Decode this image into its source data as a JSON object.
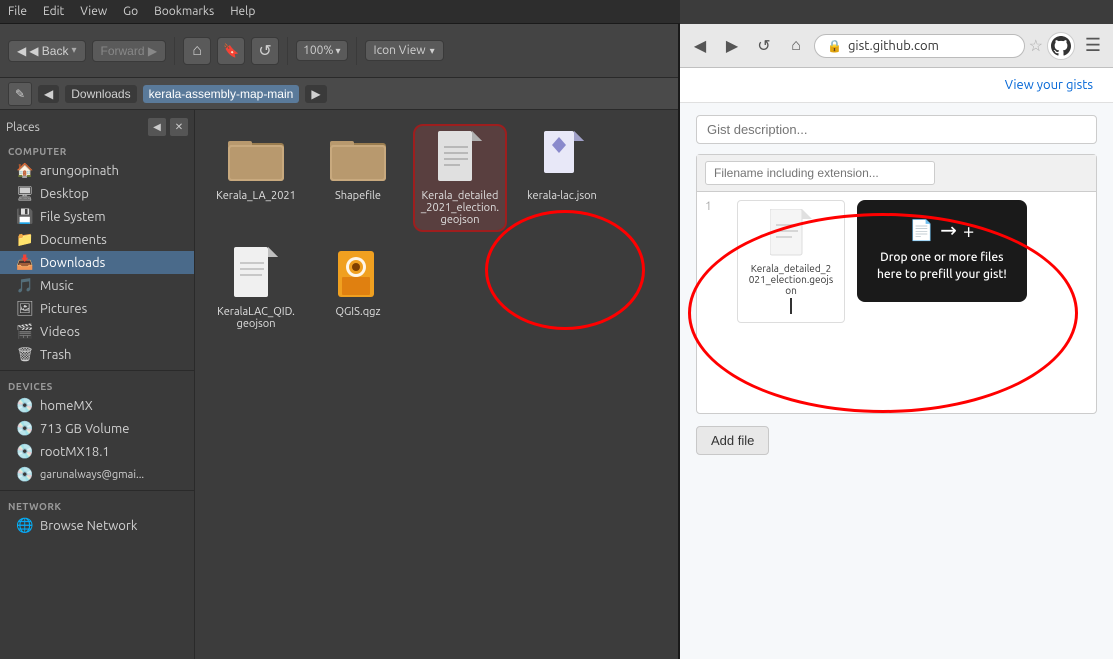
{
  "menubar": {
    "items": [
      "File",
      "Edit",
      "View",
      "Go",
      "Bookmarks",
      "Help"
    ]
  },
  "toolbar": {
    "back_label": "◀ Back",
    "back_dropdown": "▾",
    "forward_label": "Forward ▶",
    "home_symbol": "⌂",
    "bookmark_symbol": "🔖",
    "reload_symbol": "↺",
    "percent_label": "100%",
    "percent_dropdown": "▾",
    "view_label": "Icon View",
    "view_dropdown": "▾"
  },
  "breadcrumb": {
    "edit_symbol": "✎",
    "back_arrow": "◀",
    "path_parts": [
      "Downloads",
      "kerala-assembly-map-main"
    ],
    "forward_arrow": "▶"
  },
  "sidebar": {
    "header_label": "Places",
    "collapse_label": "◀",
    "close_label": "✕",
    "section_computer": "Computer",
    "items_computer": [
      {
        "label": "arungopinath",
        "icon": "🏠"
      },
      {
        "label": "Desktop",
        "icon": "🖥"
      },
      {
        "label": "File System",
        "icon": "💾"
      },
      {
        "label": "Documents",
        "icon": "📁"
      },
      {
        "label": "Downloads",
        "icon": "📥"
      },
      {
        "label": "Music",
        "icon": "🎵"
      },
      {
        "label": "Pictures",
        "icon": "🖼"
      },
      {
        "label": "Videos",
        "icon": "🎬"
      },
      {
        "label": "Trash",
        "icon": "🗑"
      }
    ],
    "section_devices": "Devices",
    "items_devices": [
      {
        "label": "homeMX",
        "icon": "💿"
      },
      {
        "label": "713 GB Volume",
        "icon": "💿"
      },
      {
        "label": "rootMX18.1",
        "icon": "💿"
      },
      {
        "label": "garunalways@gmai...",
        "icon": "💿"
      }
    ],
    "section_network": "Network",
    "items_network": [
      {
        "label": "Browse Network",
        "icon": "🌐"
      }
    ]
  },
  "files": [
    {
      "name": "Kerala_LA_2021",
      "type": "folder",
      "selected": false,
      "row": 0
    },
    {
      "name": "Shapefile",
      "type": "folder",
      "selected": false,
      "row": 0
    },
    {
      "name": "Kerala_detailed_2021_election.geojson",
      "type": "file-generic",
      "selected": true,
      "row": 0
    },
    {
      "name": "kerala-lac.json",
      "type": "file-json",
      "selected": false,
      "row": 1
    },
    {
      "name": "KeralaLAC_QID.geojson",
      "type": "file-generic",
      "selected": false,
      "row": 1
    },
    {
      "name": "QGIS.qgz",
      "type": "file-qgis",
      "selected": false,
      "row": 1
    }
  ],
  "browser": {
    "url": "gist.github.com",
    "lock_symbol": "🔒",
    "star_symbol": "☆",
    "hamburger_symbol": "☰",
    "github_symbol": "⊙",
    "back_disabled": false,
    "forward_disabled": false,
    "reload_symbol": "↺",
    "home_symbol": "⌂",
    "gist_header_label": "View your gists",
    "description_placeholder": "Gist description...",
    "filename_placeholder": "Filename including extension...",
    "line_num": "1",
    "file_preview_name": "Kerala_detailed_2021_election.geojson",
    "drop_zone_icons": "📄 → +",
    "drop_zone_text": "Drop one or more files\nhere to prefill your gist!",
    "add_file_label": "Add file"
  }
}
